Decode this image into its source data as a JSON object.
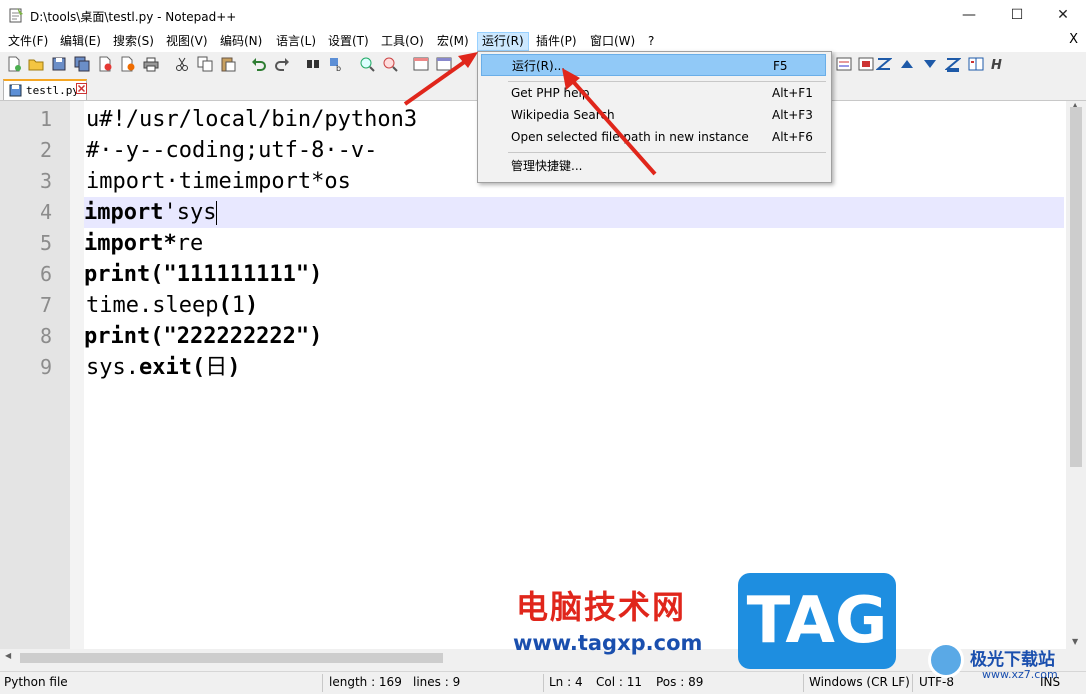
{
  "window": {
    "title": "D:\\tools\\桌面\\testl.py - Notepad++",
    "minimize": "—",
    "maximize": "☐",
    "close": "✕"
  },
  "menu": {
    "items": [
      "文件(F)",
      "编辑(E)",
      "搜索(S)",
      "视图(V)",
      "编码(N)",
      "语言(L)",
      "设置(T)",
      "工具(O)",
      "宏(M)",
      "运行(R)",
      "插件(P)",
      "窗口(W)",
      "?"
    ],
    "active_index": 9,
    "close_doc": "X"
  },
  "tab": {
    "label": "testl.py"
  },
  "editor": {
    "line_numbers": [
      "1",
      "2",
      "3",
      "4",
      "5",
      "6",
      "7",
      "8",
      "9"
    ],
    "current_line": 4,
    "lines": [
      [
        {
          "t": "u#!/usr/local/bin/python3",
          "k": false
        }
      ],
      [
        {
          "t": "#·-y--coding;utf-8·-v-",
          "k": false
        }
      ],
      [
        {
          "t": "import·timeimport*os",
          "k": false
        }
      ],
      [
        {
          "t": "import",
          "k": true
        },
        {
          "t": "'sys",
          "k": false
        }
      ],
      [
        {
          "t": "import*",
          "k": true
        },
        {
          "t": "re",
          "k": false
        }
      ],
      [
        {
          "t": "print(\"111111111\")",
          "k": true
        }
      ],
      [
        {
          "t": "time.sleep",
          "k": false
        },
        {
          "t": "(",
          "k": true
        },
        {
          "t": "1",
          "k": false
        },
        {
          "t": ")",
          "k": true
        }
      ],
      [
        {
          "t": "print(\"222222222\")",
          "k": true
        }
      ],
      [
        {
          "t": "sys.",
          "k": false
        },
        {
          "t": "exit(",
          "k": true
        },
        {
          "t": "日",
          "k": false
        },
        {
          "t": ")",
          "k": true
        }
      ]
    ]
  },
  "run_menu": {
    "items": [
      {
        "label": "运行(R)...",
        "shortcut": "F5"
      },
      {
        "label": "Get PHP help",
        "shortcut": "Alt+F1"
      },
      {
        "label": "Wikipedia Search",
        "shortcut": "Alt+F3"
      },
      {
        "label": "Open selected file path in new instance",
        "shortcut": "Alt+F6"
      },
      {
        "label": "管理快捷键...",
        "shortcut": ""
      }
    ]
  },
  "status": {
    "file_type": "Python file",
    "length": "length : 169",
    "lines": "lines : 9",
    "ln": "Ln : 4",
    "col": "Col : 11",
    "pos": "Pos : 89",
    "eol": "Windows (CR LF)",
    "encoding": "UTF-8",
    "ins": "INS"
  },
  "watermark": {
    "site_cn": "电脑技术网",
    "site_url": "www.tagxp.com",
    "tag": "TAG",
    "brand": "极光下载站",
    "brand_url": "www.xz7.com"
  },
  "colors": {
    "arrow": "#e0261b",
    "current_line": "#e8e8ff",
    "menu_highlight": "#91c9f7",
    "tag_bg": "#1e8ee0"
  }
}
